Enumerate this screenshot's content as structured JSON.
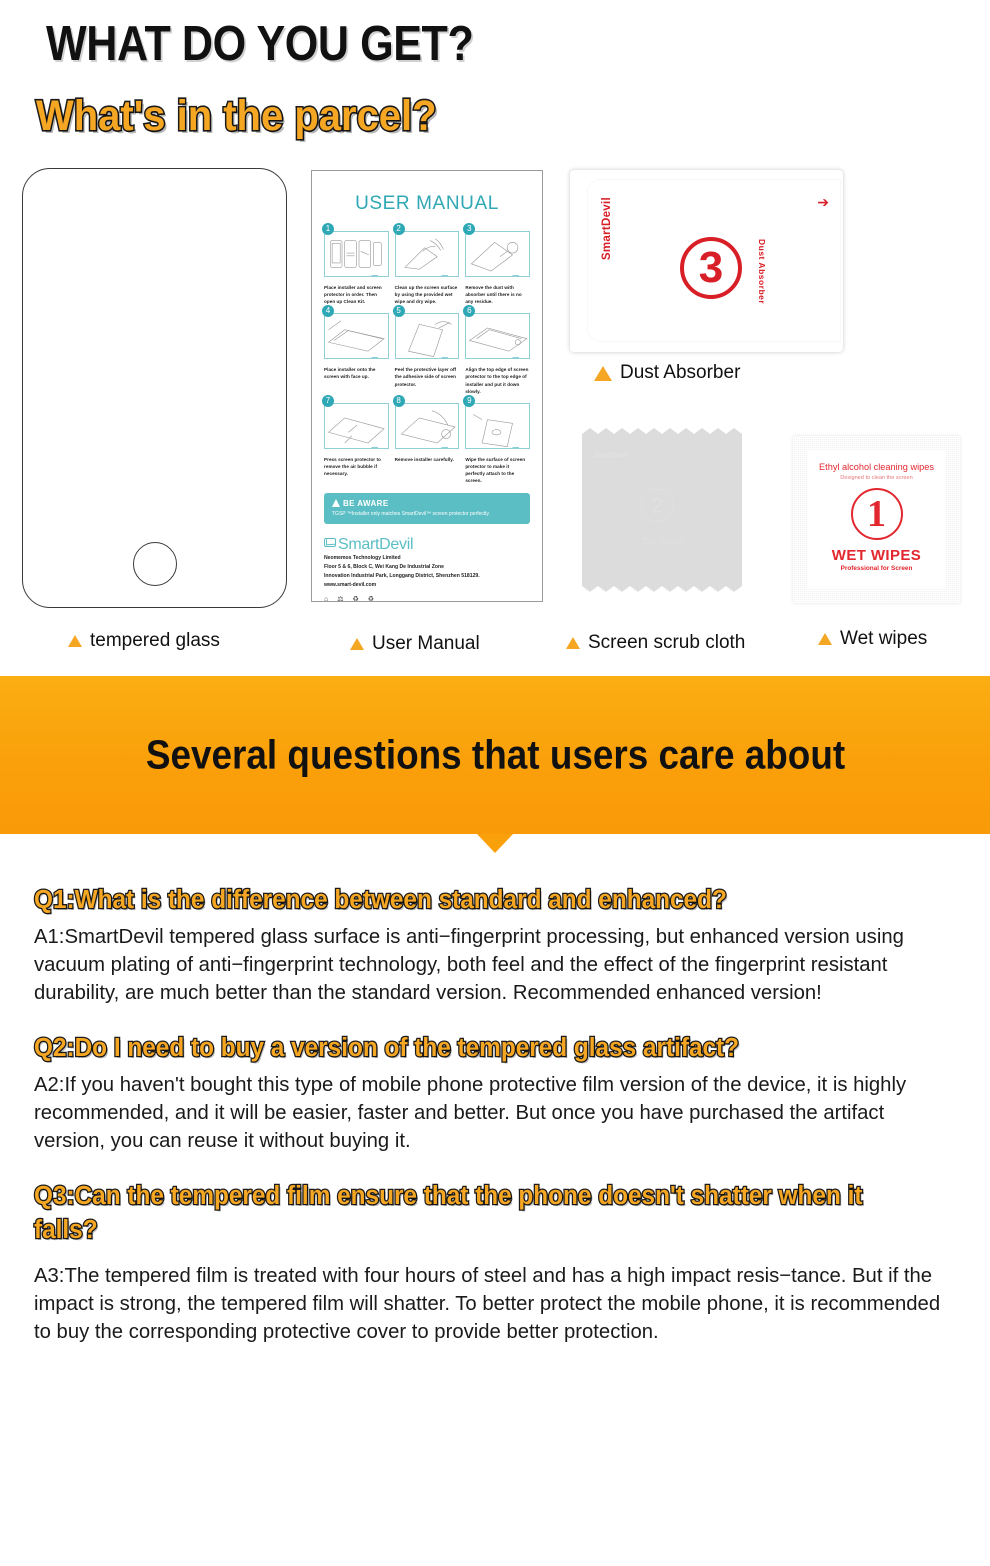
{
  "colors": {
    "accent_orange": "#F5A623",
    "banner_orange": "#FAA00A",
    "teal": "#5BBEC4",
    "red": "#D81E27",
    "cloth_gray": "#DCDCDC"
  },
  "header": {
    "title": "WHAT DO YOU GET?",
    "subtitle": "What's in the parcel?"
  },
  "items": {
    "tempered_glass": {
      "caption": "tempered glass"
    },
    "user_manual": {
      "caption": "User Manual",
      "title": "USER MANUAL",
      "steps": [
        {
          "num": "1",
          "text": "Place installer and screen protector in order. Then open up Clean Kit."
        },
        {
          "num": "2",
          "text": "Clean up the screen surface by using the provided wet wipe and dry wipe."
        },
        {
          "num": "3",
          "text": "Remove the dust with absorber until there is no any residue."
        },
        {
          "num": "4",
          "text": "Place installer onto the screen with face up."
        },
        {
          "num": "5",
          "text": "Peel the protective layer off the adhesive side of screen protector."
        },
        {
          "num": "6",
          "text": "Align the top edge of screen protector to the top edge of installer and put it down slowly."
        },
        {
          "num": "7",
          "text": "Press screen protector to remove the air bubble if necessary."
        },
        {
          "num": "8",
          "text": "Remove installer carefully."
        },
        {
          "num": "9",
          "text": "Wipe the surface of screen protector to make it perfectly attach to the screen."
        }
      ],
      "aware": {
        "title": "BE AWARE",
        "body": "TGSP ™Installer only matches SmartDevil™ screen protector perfectly."
      },
      "brand": {
        "name": "SmartDevil",
        "lines": [
          "Neomemos Technology Limited",
          "Floor 5 & 6, Block C, Wei Kang De Industrial Zone",
          "Innovation Industrial Park, Longgang District, Shenzhen 518129.",
          "www.smart-devil.com"
        ]
      }
    },
    "dust_absorber": {
      "caption": "Dust Absorber",
      "brand": "SmartDevil",
      "label": "Dust Absorber",
      "number": "3"
    },
    "screen_scrub_cloth": {
      "caption": "Screen scrub cloth",
      "brand": "SmartDevil",
      "number": "2",
      "label": "Dry Wipes"
    },
    "wet_wipes": {
      "caption": "Wet wipes",
      "line1": "Ethyl alcohol cleaning wipes",
      "line2": "Designed to clean the screen",
      "number": "1",
      "line3": "WET WIPES",
      "line4": "Professional for Screen"
    }
  },
  "banner": {
    "title": "Several questions that users care about"
  },
  "faq": [
    {
      "q": "Q1:What is the difference between standard and enhanced?",
      "a": "A1:SmartDevil tempered glass surface is anti−fingerprint processing, but enhanced version using vacuum plating of anti−fingerprint technology, both feel and the effect of the fingerprint resistant durability, are much better than the standard version. Recommended enhanced version!"
    },
    {
      "q": "Q2:Do I need to buy a version of the tempered glass artifact?",
      "a": "A2:If you haven't bought this type of mobile phone protective film version of the device, it is highly recommended, and it will be easier, faster and better. But once you have purchased the artifact version, you can reuse it without buying it."
    },
    {
      "q": "Q3:Can the tempered film ensure that the phone doesn't shatter when it falls?",
      "a": "A3:The tempered film is treated with four hours of steel and has a high impact resis−tance. But if the impact is strong, the tempered film will shatter. To better protect the mobile phone, it is recommended to buy the corresponding protective cover to provide better protection."
    }
  ]
}
